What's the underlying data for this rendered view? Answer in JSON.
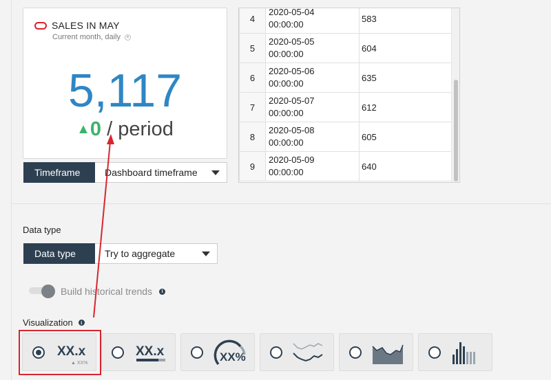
{
  "widget": {
    "title": "SALES IN MAY",
    "subtitle": "Current month, daily",
    "value": "5,117",
    "trend_arrow": "▲",
    "trend_value": "0",
    "period_text": " / period",
    "value_color": "#2f86c4",
    "trend_color": "#3bb36a"
  },
  "timeframe": {
    "label": "Timeframe",
    "value": "Dashboard timeframe"
  },
  "table": {
    "rows": [
      {
        "idx": "4",
        "date": "2020-05-04",
        "time": "00:00:00",
        "value": "583"
      },
      {
        "idx": "5",
        "date": "2020-05-05",
        "time": "00:00:00",
        "value": "604"
      },
      {
        "idx": "6",
        "date": "2020-05-06",
        "time": "00:00:00",
        "value": "635"
      },
      {
        "idx": "7",
        "date": "2020-05-07",
        "time": "00:00:00",
        "value": "612"
      },
      {
        "idx": "8",
        "date": "2020-05-08",
        "time": "00:00:00",
        "value": "605"
      },
      {
        "idx": "9",
        "date": "2020-05-09",
        "time": "00:00:00",
        "value": "640"
      }
    ]
  },
  "data_type": {
    "section_label": "Data type",
    "label": "Data type",
    "value": "Try to aggregate"
  },
  "historical": {
    "label": "Build historical trends",
    "enabled": false
  },
  "visualization": {
    "label": "Visualization",
    "options": [
      {
        "name": "number-with-trend",
        "text": "XX.x",
        "subtext": "▲ XX%",
        "selected": true
      },
      {
        "name": "number-with-bar",
        "text": "XX.x",
        "selected": false
      },
      {
        "name": "gauge",
        "text": "XX%",
        "selected": false
      },
      {
        "name": "line-sparkline",
        "selected": false
      },
      {
        "name": "area-sparkline",
        "selected": false
      },
      {
        "name": "column-sparkline",
        "selected": false
      }
    ],
    "accent_color": "#2d4052",
    "highlight_color": "#d7262f"
  },
  "icons": {
    "brand": "oracle-ring-icon",
    "info": "info-icon",
    "caret": "chevron-down-icon"
  }
}
